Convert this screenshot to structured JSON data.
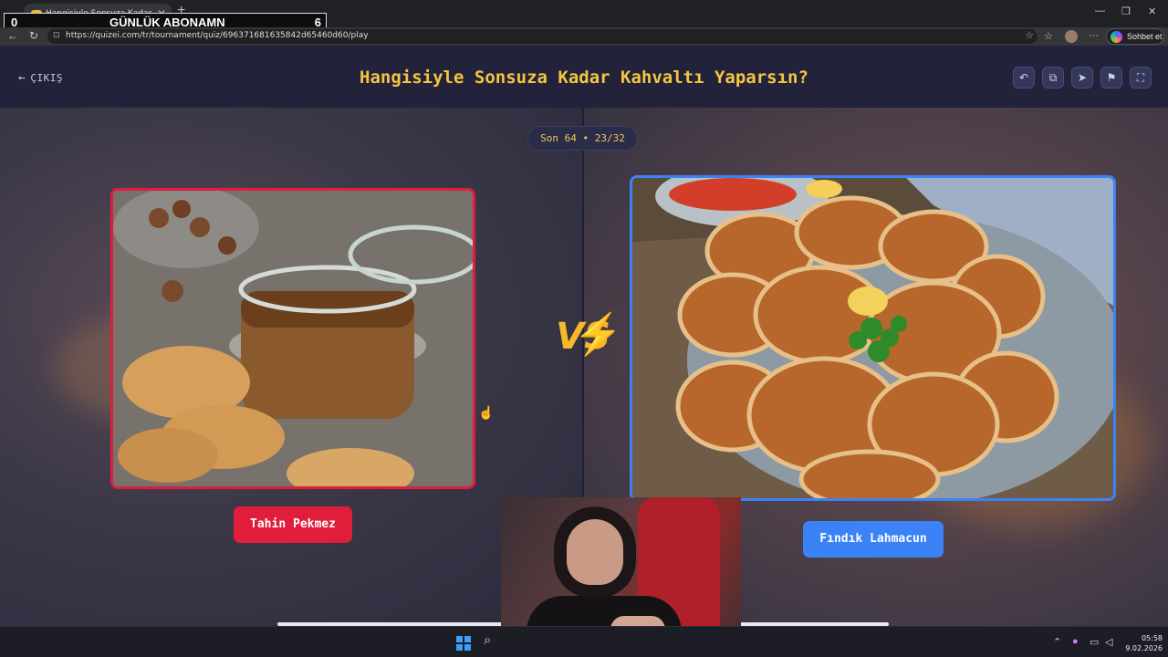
{
  "browser": {
    "tab_title": "Hangisiyle Sonsuza Kadar Kahvalt",
    "url": "https://quizei.com/tr/tournament/quiz/696371681635842d65460d60/play",
    "copilot_label": "Sohbet et"
  },
  "stream_overlay": {
    "left_value": "0",
    "label": "GÜNLÜK ABONAMN",
    "right_value": "6"
  },
  "header": {
    "exit_label": "ÇIKIŞ",
    "title": "Hangisiyle Sonsuza Kadar Kahvaltı Yaparsın?"
  },
  "round": {
    "label": "Son 64 • 23/32"
  },
  "left_choice": {
    "name": "Tahin Pekmez",
    "accent": "#e11d3c"
  },
  "right_choice": {
    "name": "Fındık Lahmacun",
    "accent": "#3b82f6"
  },
  "vs_label": "VS",
  "taskbar": {
    "time": "05:58",
    "date": "9.02.2026"
  },
  "colors": {
    "title": "#f5c542",
    "page_bg": "#25263b"
  }
}
